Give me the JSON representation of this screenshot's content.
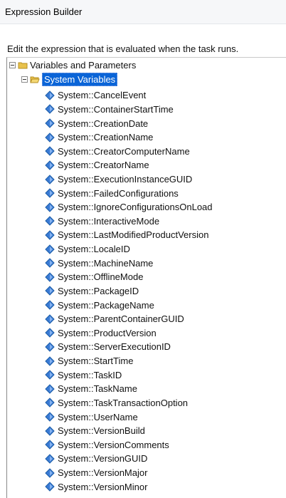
{
  "window": {
    "title": "Expression Builder"
  },
  "instruction": "Edit the expression that is evaluated when the task runs.",
  "tree": {
    "root": {
      "label": "Variables and Parameters",
      "icon": "folder-icon"
    },
    "group": {
      "label": "System Variables",
      "icon": "open-folder-icon",
      "selected": true
    },
    "variables": [
      "System::CancelEvent",
      "System::ContainerStartTime",
      "System::CreationDate",
      "System::CreationName",
      "System::CreatorComputerName",
      "System::CreatorName",
      "System::ExecutionInstanceGUID",
      "System::FailedConfigurations",
      "System::IgnoreConfigurationsOnLoad",
      "System::InteractiveMode",
      "System::LastModifiedProductVersion",
      "System::LocaleID",
      "System::MachineName",
      "System::OfflineMode",
      "System::PackageID",
      "System::PackageName",
      "System::ParentContainerGUID",
      "System::ProductVersion",
      "System::ServerExecutionID",
      "System::StartTime",
      "System::TaskID",
      "System::TaskName",
      "System::TaskTransactionOption",
      "System::UserName",
      "System::VersionBuild",
      "System::VersionComments",
      "System::VersionGUID",
      "System::VersionMajor",
      "System::VersionMinor"
    ]
  },
  "colors": {
    "selection": "#0a64d7",
    "variable_icon": "#3a7bd5",
    "folder": "#e8c24c"
  }
}
